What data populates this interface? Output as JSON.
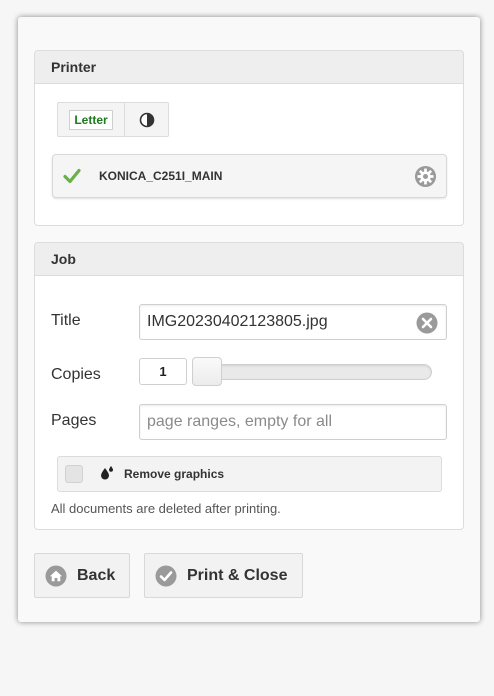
{
  "printer_panel": {
    "header": "Printer",
    "paper_label": "Letter",
    "contrast_icon": "half-circle-icon",
    "printer_name": "KONICA_C251I_MAIN",
    "status_icon": "check-icon",
    "settings_icon": "gear-icon"
  },
  "job_panel": {
    "header": "Job",
    "title_label": "Title",
    "title_value": "IMG20230402123805.jpg",
    "clear_icon": "clear-icon",
    "copies_label": "Copies",
    "copies_value": "1",
    "copies_slider_fraction": 0,
    "pages_label": "Pages",
    "pages_placeholder": "page ranges, empty for all",
    "remove_graphics_label": "Remove graphics",
    "remove_graphics_icon": "drops-icon",
    "remove_graphics_checked": false,
    "note": "All documents are deleted after printing."
  },
  "buttons": {
    "back_label": "Back",
    "back_icon": "home-icon",
    "print_label": "Print & Close",
    "print_icon": "check-circle-icon"
  },
  "colors": {
    "check_green": "#6ab04c",
    "letter_green": "#1d7a1d",
    "icon_gray": "#9a9a9a"
  }
}
